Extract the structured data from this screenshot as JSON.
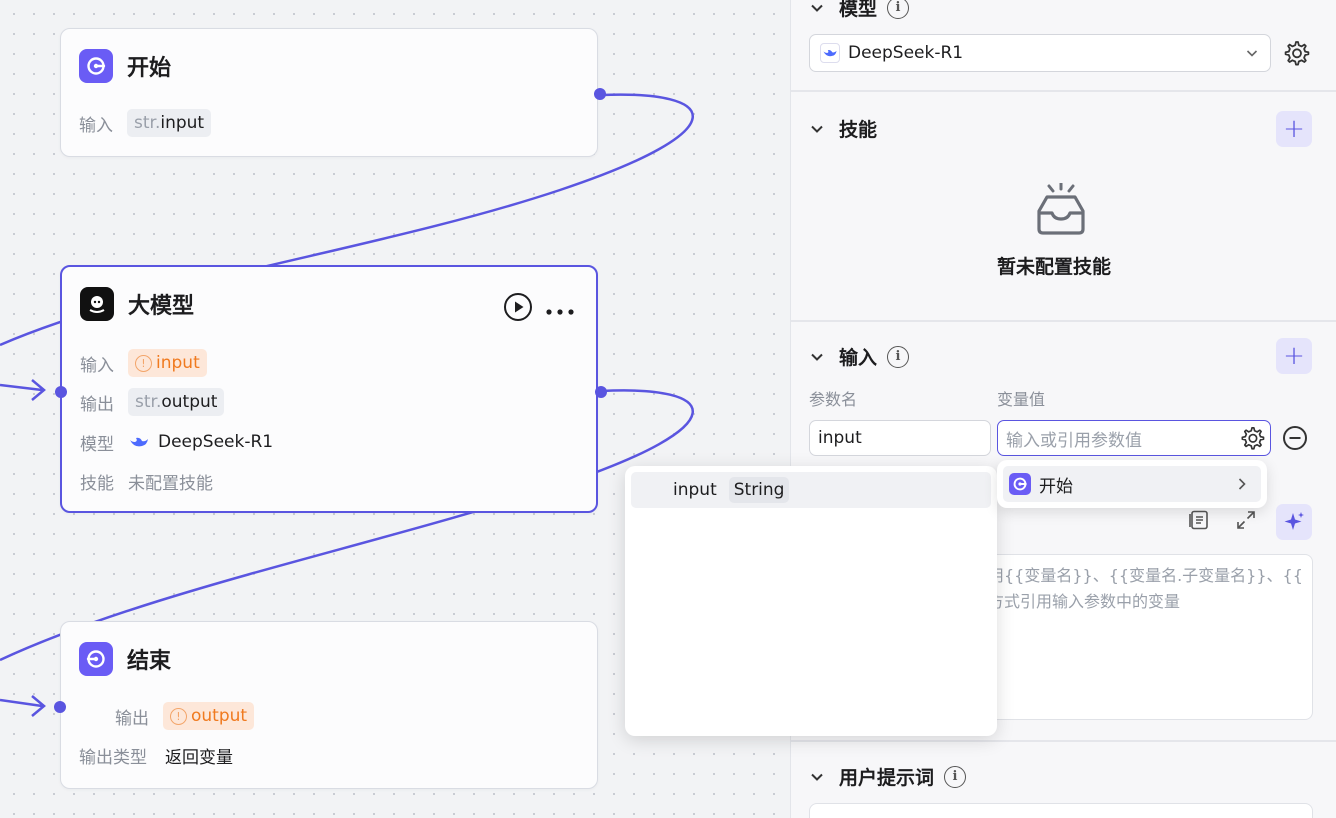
{
  "canvas": {
    "start_node": {
      "title": "开始",
      "input_label": "输入",
      "input_prefix": "str.",
      "input_value": "input"
    },
    "llm_node": {
      "title": "大模型",
      "input_label": "输入",
      "input_value": "input",
      "output_label": "输出",
      "output_prefix": "str.",
      "output_value": "output",
      "model_label": "模型",
      "model_value": "DeepSeek-R1",
      "skill_label": "技能",
      "skill_value": "未配置技能"
    },
    "end_node": {
      "title": "结束",
      "output_label": "输出",
      "output_value": "output",
      "output_type_label": "输出类型",
      "output_type_value": "返回变量"
    }
  },
  "panel": {
    "model_section": {
      "title": "模型",
      "selected_model": "DeepSeek-R1"
    },
    "skills_section": {
      "title": "技能",
      "empty_text": "暂未配置技能"
    },
    "input_section": {
      "title": "输入",
      "param_name_header": "参数名",
      "var_value_header": "变量值",
      "param_name_value": "input",
      "var_value_placeholder": "输入或引用参数值"
    },
    "system_prompt": {
      "placeholder_line1": "用{{变量名}}、{{变量名.子变量名}}、{{",
      "placeholder_line2": "方式引用输入参数中的变量"
    },
    "user_prompt_section": {
      "title": "用户提示词"
    }
  },
  "variable_popup": {
    "source_node": "开始",
    "var_name": "input",
    "var_type": "String"
  },
  "colors": {
    "accent": "#5a55e0",
    "warning": "#f07a1f"
  }
}
